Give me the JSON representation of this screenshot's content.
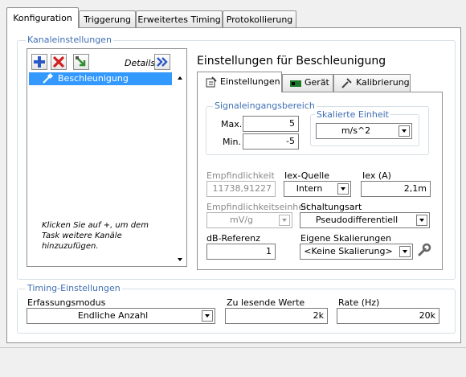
{
  "tabs": [
    {
      "label": "Konfiguration",
      "active": true
    },
    {
      "label": "Triggerung",
      "active": false
    },
    {
      "label": "Erweitertes Timing",
      "active": false
    },
    {
      "label": "Protokollierung",
      "active": false
    }
  ],
  "channel_settings": {
    "group_label": "Kanaleinstellungen",
    "details_label": "Details",
    "channels": [
      {
        "name": "Beschleunigung",
        "selected": true
      }
    ],
    "hint": "Klicken Sie auf +, um dem Task weitere Kanäle hinzuzufügen."
  },
  "settings_panel": {
    "title": "Einstellungen für Beschleunigung",
    "subtabs": [
      {
        "label": "Einstellungen",
        "icon": "settings-icon",
        "active": true
      },
      {
        "label": "Gerät",
        "icon": "device-icon",
        "active": false
      },
      {
        "label": "Kalibrierung",
        "icon": "calibration-icon",
        "active": false
      }
    ],
    "signal_range": {
      "group_label": "Signaleingangsbereich",
      "max_label": "Max.",
      "max_value": "5",
      "min_label": "Min.",
      "min_value": "-5"
    },
    "scaled_unit": {
      "group_label": "Skalierte Einheit",
      "value": "m/s^2"
    },
    "sensitivity": {
      "label": "Empfindlichkeit",
      "value": "11738,91227"
    },
    "iex_source": {
      "label": "Iex-Quelle",
      "value": "Intern"
    },
    "iex": {
      "label": "Iex (A)",
      "value": "2,1m"
    },
    "sensitivity_unit": {
      "label": "Empfindlichkeitseinheit",
      "value": "mV/g"
    },
    "wiring": {
      "label": "Schaltungsart",
      "value": "Pseudodifferentiell"
    },
    "db_reference": {
      "label": "dB-Referenz",
      "value": "1"
    },
    "custom_scaling": {
      "label": "Eigene Skalierungen",
      "value": "<Keine Skalierung>"
    }
  },
  "timing": {
    "group_label": "Timing-Einstellungen",
    "mode_label": "Erfassungsmodus",
    "mode_value": "Endliche Anzahl",
    "samples_label": "Zu lesende Werte",
    "samples_value": "2k",
    "rate_label": "Rate (Hz)",
    "rate_value": "20k"
  },
  "colors": {
    "accent": "#3f6fb3",
    "selection": "#3399ff",
    "group_label": "#3f6fb3"
  }
}
